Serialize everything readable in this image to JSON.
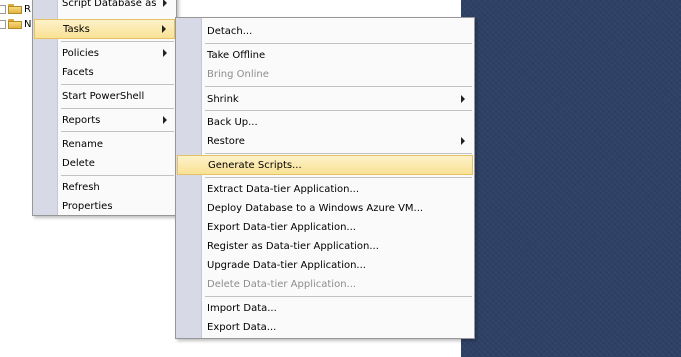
{
  "tree": {
    "items": [
      {
        "label": "R"
      },
      {
        "label": "N"
      }
    ]
  },
  "context_menu": {
    "items": [
      {
        "label": "Script Database as",
        "submenu": true
      },
      {
        "label": "Tasks",
        "submenu": true,
        "highlighted": true
      },
      {
        "label": "Policies",
        "submenu": true
      },
      {
        "label": "Facets"
      },
      {
        "label": "Start PowerShell"
      },
      {
        "label": "Reports",
        "submenu": true
      },
      {
        "label": "Rename"
      },
      {
        "label": "Delete"
      },
      {
        "label": "Refresh"
      },
      {
        "label": "Properties"
      }
    ]
  },
  "tasks_menu": {
    "items": [
      {
        "label": "Detach..."
      },
      {
        "label": "Take Offline"
      },
      {
        "label": "Bring Online",
        "disabled": true
      },
      {
        "label": "Shrink",
        "submenu": true
      },
      {
        "label": "Back Up..."
      },
      {
        "label": "Restore",
        "submenu": true
      },
      {
        "label": "Generate Scripts...",
        "highlighted": true
      },
      {
        "label": "Extract Data-tier Application..."
      },
      {
        "label": "Deploy Database to a Windows Azure VM..."
      },
      {
        "label": "Export Data-tier Application..."
      },
      {
        "label": "Register as Data-tier Application..."
      },
      {
        "label": "Upgrade Data-tier Application..."
      },
      {
        "label": "Delete Data-tier Application...",
        "disabled": true
      },
      {
        "label": "Import Data..."
      },
      {
        "label": "Export Data..."
      }
    ]
  },
  "colors": {
    "highlight": "#f9e294",
    "gutter": "#d7dae6",
    "right_panel": "#2e4166"
  }
}
